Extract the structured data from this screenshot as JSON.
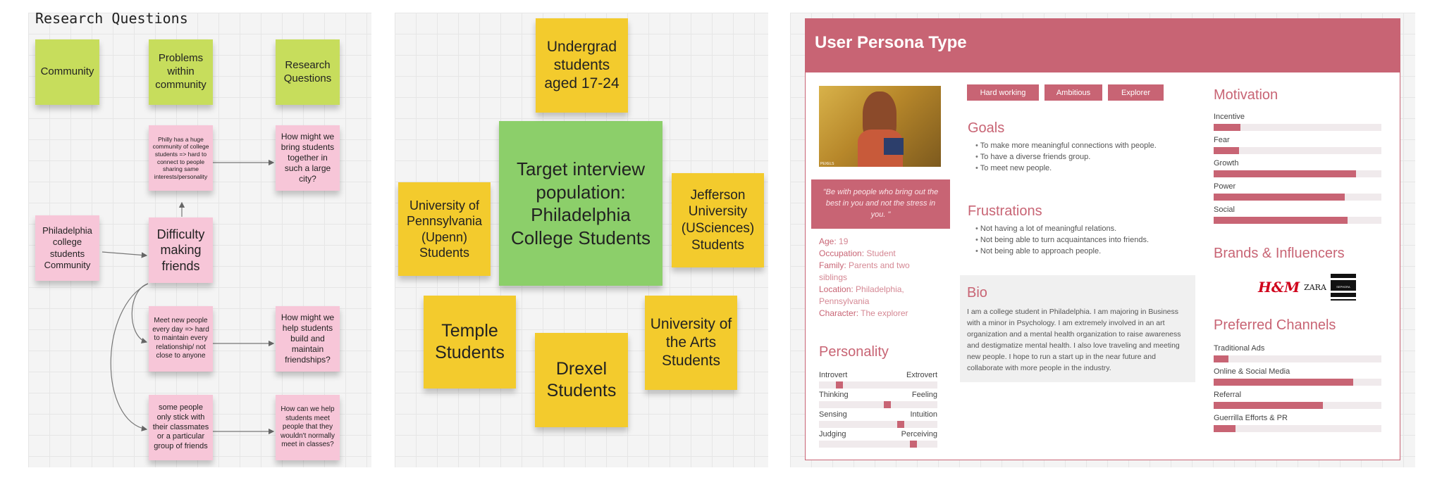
{
  "board1": {
    "title": "Research Questions",
    "headers": [
      "Community",
      "Problems within community",
      "Research Questions"
    ],
    "community_note": "Philadelphia college students Community",
    "difficulty_note": "Difficulty making friends",
    "problems": [
      "Philly has a huge community of college students => hard to connect to people sharing same interests/personality",
      "Meet new people every day => hard to maintain every relationship/ not close to anyone",
      "some people only stick with their classmates or a particular group of friends"
    ],
    "questions": [
      "How might we bring students together in such a large city?",
      "How might we help students build and maintain friendships?",
      "How can we help students meet people that they wouldn't normally meet in classes?"
    ]
  },
  "board2": {
    "center": "Target interview population: Philadelphia College Students",
    "notes": [
      "Undergrad students aged 17-24",
      "University of Pennsylvania (Upenn) Students",
      "Jefferson University (USciences) Students",
      "Temple Students",
      "Drexel Students",
      "University of the Arts Students"
    ]
  },
  "persona": {
    "title": "User Persona Type",
    "accent": "#c86474",
    "photo_caption_left": "PEXELS",
    "photo_caption_right": "",
    "quote": "\"Be with people who bring out the best in you and not the stress in you. \"",
    "facts": [
      {
        "key": "Age:",
        "value": "19"
      },
      {
        "key": "Occupation:",
        "value": "Student"
      },
      {
        "key": "Family:",
        "value": "Parents and two siblings"
      },
      {
        "key": "Location:",
        "value": "Philadelphia, Pennsylvania"
      },
      {
        "key": "Character:",
        "value": "The explorer"
      }
    ],
    "tags": [
      "Hard working",
      "Ambitious",
      "Explorer"
    ],
    "goals_title": "Goals",
    "goals": [
      "To make more meaningful connections with people.",
      "To have a diverse friends group.",
      "To meet new people."
    ],
    "frustrations_title": "Frustrations",
    "frustrations": [
      "Not having a lot of meaningful relations.",
      "Not being able to turn acquaintances into friends.",
      "Not being able to approach people."
    ],
    "bio_title": "Bio",
    "bio": "I am a college student in Philadelphia. I am majoring in Business with a minor in Psychology. I am extremely involved in an art organization and a mental health organization to raise awareness and destigmatize mental health.  I also love traveling and meeting new people. I hope to run a start up in the near future and collaborate with more people in the industry.",
    "personality_title": "Personality",
    "personality": [
      {
        "left": "Introvert",
        "right": "Extrovert",
        "value": 0.17
      },
      {
        "left": "Thinking",
        "right": "Feeling",
        "value": 0.58
      },
      {
        "left": "Sensing",
        "right": "Intuition",
        "value": 0.69
      },
      {
        "left": "Judging",
        "right": "Perceiving",
        "value": 0.8
      }
    ],
    "motivation_title": "Motivation",
    "motivation": [
      {
        "label": "Incentive",
        "value": 0.16
      },
      {
        "label": "Fear",
        "value": 0.15
      },
      {
        "label": "Growth",
        "value": 0.85
      },
      {
        "label": "Power",
        "value": 0.78
      },
      {
        "label": "Social",
        "value": 0.8
      }
    ],
    "brands_title": "Brands & Influencers",
    "brands": [
      "H&M",
      "ZARA",
      "SEPHORA"
    ],
    "channels_title": "Preferred Channels",
    "channels": [
      {
        "label": "Traditional Ads",
        "value": 0.09
      },
      {
        "label": "Online & Social Media",
        "value": 0.83
      },
      {
        "label": "Referral",
        "value": 0.65
      },
      {
        "label": "Guerrilla Efforts & PR",
        "value": 0.13
      }
    ]
  }
}
